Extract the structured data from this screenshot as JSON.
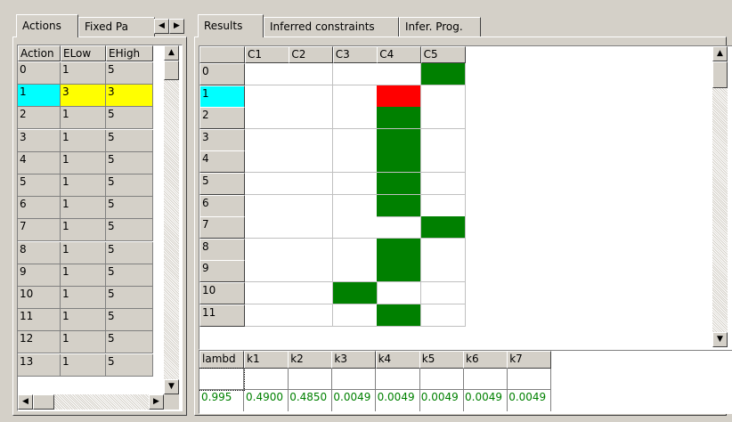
{
  "left_panel": {
    "tabs": [
      "Actions",
      "Fixed Pa"
    ],
    "columns": [
      "Action",
      "ELow",
      "EHigh"
    ],
    "rows": [
      [
        "0",
        "1",
        "5"
      ],
      [
        "1",
        "3",
        "3"
      ],
      [
        "2",
        "1",
        "5"
      ],
      [
        "3",
        "1",
        "5"
      ],
      [
        "4",
        "1",
        "5"
      ],
      [
        "5",
        "1",
        "5"
      ],
      [
        "6",
        "1",
        "5"
      ],
      [
        "7",
        "1",
        "5"
      ],
      [
        "8",
        "1",
        "5"
      ],
      [
        "9",
        "1",
        "5"
      ],
      [
        "10",
        "1",
        "5"
      ],
      [
        "11",
        "1",
        "5"
      ],
      [
        "12",
        "1",
        "5"
      ],
      [
        "13",
        "1",
        "5"
      ]
    ],
    "selected_row": 1,
    "colors": {
      "selected_key": "#00ffff",
      "selected_values": "#ffff00"
    },
    "icons": [
      "left-arrow-icon",
      "right-arrow-icon",
      "up-arrow-icon",
      "down-arrow-icon"
    ]
  },
  "right_panel": {
    "tabs": [
      "Results",
      "Inferred constraints",
      "Infer. Prog."
    ],
    "results_grid": {
      "columns": [
        "C1",
        "C2",
        "C3",
        "C4",
        "C5"
      ],
      "rows": [
        "0",
        "1",
        "2",
        "3",
        "4",
        "5",
        "6",
        "7",
        "8",
        "9",
        "10",
        "11"
      ],
      "marks": [
        {
          "row": 0,
          "col": 4,
          "color": "green"
        },
        {
          "row": 1,
          "col": 3,
          "color": "red"
        },
        {
          "row": 2,
          "col": 3,
          "color": "green"
        },
        {
          "row": 3,
          "col": 3,
          "color": "green"
        },
        {
          "row": 4,
          "col": 3,
          "color": "green"
        },
        {
          "row": 5,
          "col": 3,
          "color": "green"
        },
        {
          "row": 6,
          "col": 3,
          "color": "green"
        },
        {
          "row": 7,
          "col": 4,
          "color": "green"
        },
        {
          "row": 8,
          "col": 3,
          "color": "green"
        },
        {
          "row": 9,
          "col": 3,
          "color": "green"
        },
        {
          "row": 10,
          "col": 2,
          "color": "green"
        },
        {
          "row": 11,
          "col": 3,
          "color": "green"
        }
      ],
      "selected_row": 1
    },
    "params_grid": {
      "columns": [
        "lambd",
        "k1",
        "k2",
        "k3",
        "k4",
        "k5",
        "k6",
        "k7"
      ],
      "input_row": [
        "",
        "",
        "",
        "",
        "",
        "",
        "",
        ""
      ],
      "values": [
        "0.995",
        "0.4900",
        "0.4850",
        "0.0049",
        "0.0049",
        "0.0049",
        "0.0049",
        "0.0049"
      ]
    },
    "colors": {
      "green": "#008000",
      "red": "#ff0000",
      "selected_key": "#00ffff"
    }
  }
}
